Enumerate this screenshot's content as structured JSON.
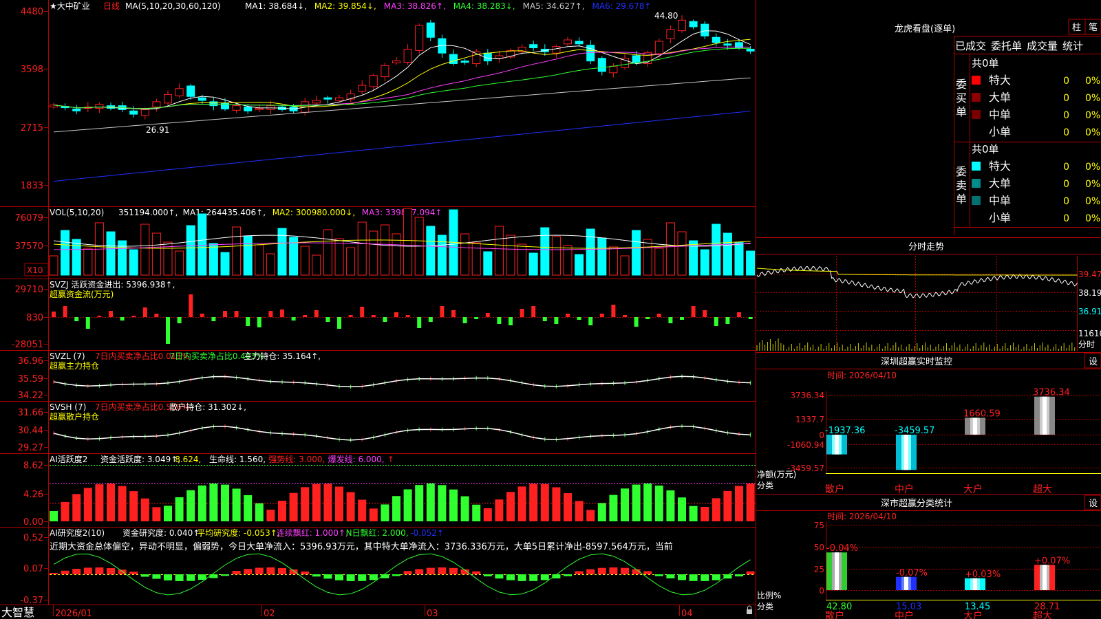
{
  "app": {
    "name": "大智慧"
  },
  "colors": {
    "up": "#ff2020",
    "down": "#00ffff",
    "grid": "#b40000",
    "yellow": "#ffff00",
    "magenta": "#ff40ff",
    "green": "#30ff30",
    "white": "#ffffff",
    "blue": "#2030ff",
    "gray": "#c8c8c8"
  },
  "price_panel": {
    "title": "★大中矿业",
    "period": "日线",
    "ma_title": "MA(5,10,20,30,60,120)",
    "ma_items": [
      {
        "label": "MA1: 38.684↓,",
        "color": "#ffffff"
      },
      {
        "label": "MA2: 39.854↓,",
        "color": "#ffff00"
      },
      {
        "label": "MA3: 38.826↑,",
        "color": "#ff40ff"
      },
      {
        "label": "MA4: 38.283↓,",
        "color": "#30ff30"
      },
      {
        "label": "MA5: 34.627↑,",
        "color": "#c8c8c8"
      },
      {
        "label": "MA6: 29.678↑",
        "color": "#2030ff"
      }
    ],
    "y_ticks": [
      "4480",
      "3598",
      "2715",
      "1833"
    ],
    "high_label": "44.80",
    "low_label": "26.91"
  },
  "vol_panel": {
    "title": "VOL(5,10,20)",
    "items": [
      {
        "label": "351194.000↑,",
        "color": "#ffffff"
      },
      {
        "label": "MA1: 264435.406↑,",
        "color": "#ffffff"
      },
      {
        "label": "MA2: 300980.000↓,",
        "color": "#ffff00"
      },
      {
        "label": "MA3: 339857.094↑",
        "color": "#ff40ff"
      }
    ],
    "y_ticks": [
      "76079",
      "37570"
    ],
    "unit": "X10"
  },
  "svzj_panel": {
    "title": "SVZJ 活跃资金进出: 5396.938↑,",
    "subtitle": "超赢资金流(万元)",
    "y_ticks": [
      "29710",
      "830",
      "-28051"
    ]
  },
  "svzl_panel": {
    "title": "SVZL (7)",
    "items": [
      {
        "label": "7日内买卖净占比0.011%",
        "color": "#ff2020"
      },
      {
        "label": "7日内买卖净占比0.403%",
        "color": "#30ff30"
      },
      {
        "label": "主力持仓: 35.164↑,",
        "color": "#ffffff"
      }
    ],
    "subtitle": "超赢主力持仓",
    "y_ticks": [
      "36.96",
      "35.59",
      "34.22"
    ]
  },
  "svsh_panel": {
    "title": "SVSH (7)",
    "items": [
      {
        "label": "7日内买卖净占比0.556%",
        "color": "#ff2020"
      },
      {
        "label": "散户持仓: 31.302↓,",
        "color": "#ffffff"
      }
    ],
    "subtitle": "超赢散户持仓",
    "y_ticks": [
      "31.66",
      "30.44",
      "29.27"
    ]
  },
  "ai_panel": {
    "title": "AI活跃度2",
    "items": [
      {
        "label": "资金活跃度: 3.049↑,",
        "color": "#ffffff"
      },
      {
        "label": "8.624,",
        "color": "#ffff00"
      },
      {
        "label": "生命线: 1.560,",
        "color": "#ffffff"
      },
      {
        "label": "强势线: 3.000,",
        "color": "#ff2020"
      },
      {
        "label": "爆发线: 6.000,",
        "color": "#ff40ff"
      },
      {
        "label": "↑",
        "color": "#ff2020"
      }
    ],
    "y_ticks": [
      "8.62",
      "4.26",
      "0.00"
    ]
  },
  "ai2_panel": {
    "title": "AI研究度2(10)",
    "items": [
      {
        "label": "资金研究度: 0.040↑,",
        "color": "#ffffff"
      },
      {
        "label": "平均研究度: -0.053↑,",
        "color": "#ffff00"
      },
      {
        "label": "连续飘红: 1.000↑,",
        "color": "#ff40ff"
      },
      {
        "label": "N日飘红: 2.000,",
        "color": "#30ff30"
      },
      {
        "label": "-0.052↑",
        "color": "#2030ff"
      }
    ],
    "comment": "近期大资金总体偏空，异动不明显，偏弱势，今日大单净流入：5396.93万元，其中特大单净流入：3736.336万元，大单5日累计净出-8597.564万元，当前",
    "y_ticks": [
      "0.52",
      "0.07",
      "-0.37"
    ]
  },
  "x_axis": {
    "dates": [
      "2026/01",
      "02",
      "03",
      "04"
    ]
  },
  "dragon": {
    "title": "龙虎看盘(逐单)",
    "btn_bar": "柱",
    "btn_pen": "笔",
    "tabs": [
      "已成交",
      "委托单",
      "成交量",
      "统计"
    ],
    "buy_label": "委买单",
    "sell_label": "委卖单",
    "buy_total": "共0单",
    "sell_total": "共0单",
    "rows_buy": [
      {
        "name": "特大",
        "count": "0",
        "pct": "0%",
        "color": "#ff0000"
      },
      {
        "name": "大单",
        "count": "0",
        "pct": "0%",
        "color": "#8b0000"
      },
      {
        "name": "中单",
        "count": "0",
        "pct": "0%",
        "color": "#7a0000"
      },
      {
        "name": "小单",
        "count": "0",
        "pct": "0%",
        "color": "#000000"
      }
    ],
    "rows_sell": [
      {
        "name": "特大",
        "count": "0",
        "pct": "0%",
        "color": "#00ffff"
      },
      {
        "name": "大单",
        "count": "0",
        "pct": "0%",
        "color": "#008b8b"
      },
      {
        "name": "中单",
        "count": "0",
        "pct": "0%",
        "color": "#007070"
      },
      {
        "name": "小单",
        "count": "0",
        "pct": "0%",
        "color": "#000000"
      }
    ]
  },
  "intraday": {
    "title": "分时走势",
    "labels": [
      "39.47",
      "38.19",
      "36.91",
      "11610",
      "分时"
    ]
  },
  "monitor": {
    "title": "深圳超赢实时监控",
    "btn": "设",
    "time": "时间: 2026/04/10",
    "y_ticks": [
      "3736.34",
      "1337.7",
      "0",
      "-1060.94",
      "-3459.57"
    ],
    "axis_label": "净额(万元)",
    "axis_label2": "分类",
    "bars": [
      {
        "cat": "散户",
        "value": -1937.36,
        "label": "-1937.36"
      },
      {
        "cat": "中户",
        "value": -3459.57,
        "label": "-3459.57"
      },
      {
        "cat": "大户",
        "value": 1660.59,
        "label": "1660.59"
      },
      {
        "cat": "超大",
        "value": 3736.34,
        "label": "3736.34"
      }
    ]
  },
  "classify": {
    "title": "深市超赢分类统计",
    "btn": "设",
    "time": "时间: 2026/04/10",
    "y_ticks": [
      "75",
      "50",
      "25",
      "0"
    ],
    "axis_label": "比例%",
    "axis_label2": "分类",
    "bars": [
      {
        "cat": "散户",
        "value": 42.8,
        "label": "42.80",
        "top": "-0.04%"
      },
      {
        "cat": "中户",
        "value": 15.03,
        "label": "15.03",
        "top": "-0.07%"
      },
      {
        "cat": "大户",
        "value": 13.45,
        "label": "13.45",
        "top": "+0.03%"
      },
      {
        "cat": "超大",
        "value": 28.71,
        "label": "28.71",
        "top": "+0.07%"
      }
    ]
  },
  "chart_data": [
    {
      "type": "candlestick",
      "title": "★大中矿业 日线",
      "ylim": [
        18.33,
        44.8
      ],
      "x": [
        "2026/01",
        "02",
        "03",
        "04"
      ],
      "series": [
        {
          "name": "MA1",
          "values": [
            38.684
          ]
        },
        {
          "name": "MA2",
          "values": [
            39.854
          ]
        },
        {
          "name": "MA3",
          "values": [
            38.826
          ]
        },
        {
          "name": "MA4",
          "values": [
            38.283
          ]
        },
        {
          "name": "MA5",
          "values": [
            34.627
          ]
        },
        {
          "name": "MA6",
          "values": [
            29.678
          ]
        }
      ],
      "annotations": [
        "44.80",
        "26.91"
      ]
    },
    {
      "type": "bar",
      "title": "VOL(5,10,20)",
      "series": [
        {
          "name": "VOL",
          "values": [
            351194.0
          ]
        },
        {
          "name": "MA1",
          "values": [
            264435.406
          ]
        },
        {
          "name": "MA2",
          "values": [
            300980.0
          ]
        },
        {
          "name": "MA3",
          "values": [
            339857.094
          ]
        }
      ]
    },
    {
      "type": "bar",
      "title": "深圳超赢实时监控",
      "categories": [
        "散户",
        "中户",
        "大户",
        "超大"
      ],
      "values": [
        -1937.36,
        -3459.57,
        1660.59,
        3736.34
      ],
      "ylabel": "净额(万元)"
    },
    {
      "type": "bar",
      "title": "深市超赢分类统计",
      "categories": [
        "散户",
        "中户",
        "大户",
        "超大"
      ],
      "values": [
        42.8,
        15.03,
        13.45,
        28.71
      ],
      "ylabel": "比例%",
      "ylim": [
        0,
        75
      ]
    }
  ]
}
